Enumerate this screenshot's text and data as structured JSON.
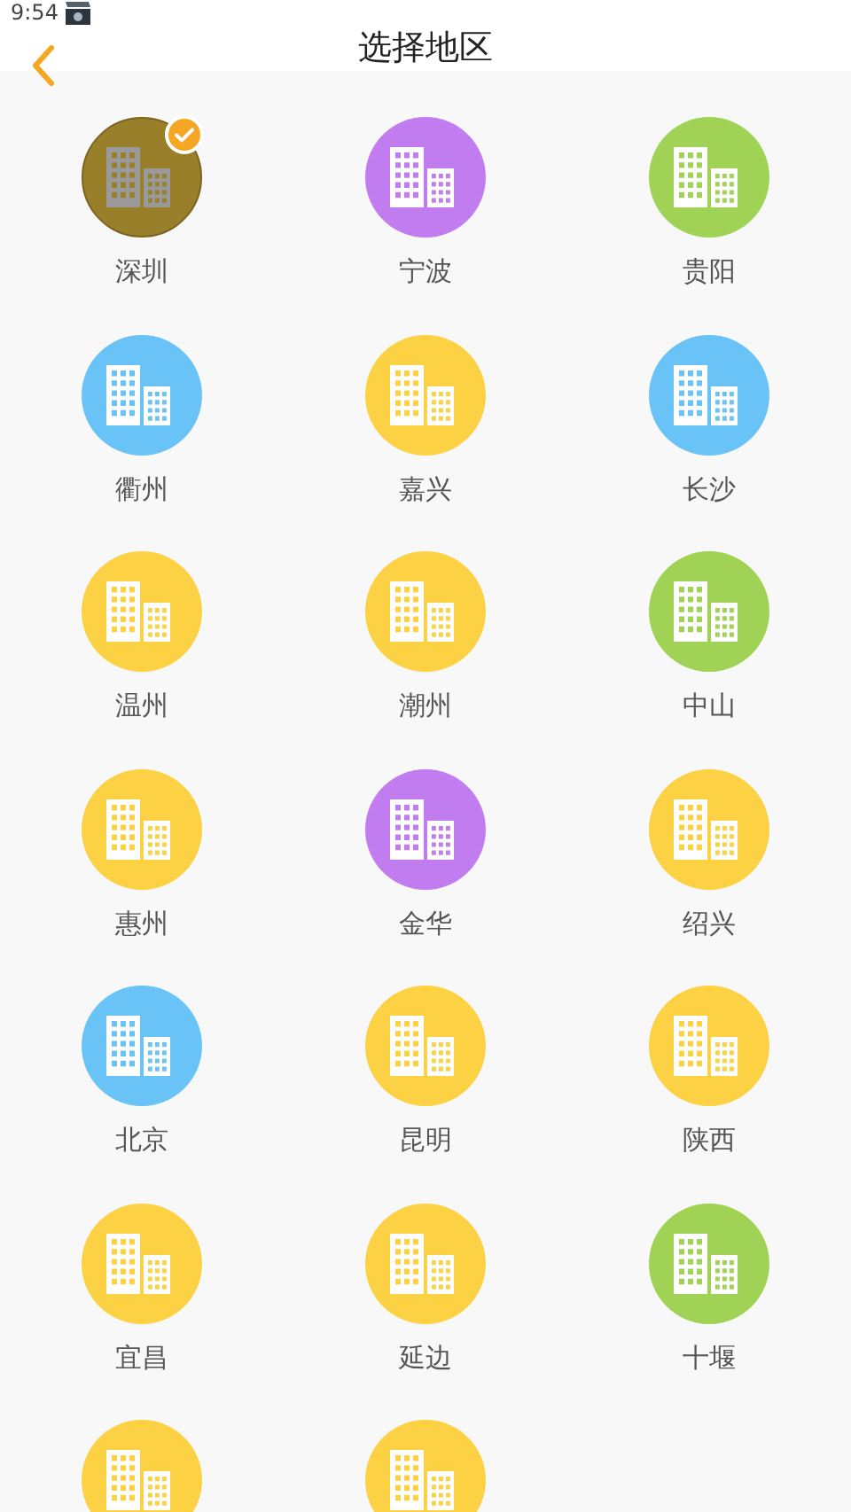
{
  "status_bar": {
    "time": "9:54"
  },
  "header": {
    "title": "选择地区"
  },
  "regions": [
    {
      "name": "深圳",
      "color": "#9a7f2a",
      "selected": true
    },
    {
      "name": "宁波",
      "color": "#c17cf0",
      "selected": false
    },
    {
      "name": "贵阳",
      "color": "#a0d255",
      "selected": false
    },
    {
      "name": "衢州",
      "color": "#6ac3f7",
      "selected": false
    },
    {
      "name": "嘉兴",
      "color": "#fcd144",
      "selected": false
    },
    {
      "name": "长沙",
      "color": "#6ac3f7",
      "selected": false
    },
    {
      "name": "温州",
      "color": "#fcd144",
      "selected": false
    },
    {
      "name": "潮州",
      "color": "#fcd144",
      "selected": false
    },
    {
      "name": "中山",
      "color": "#a0d255",
      "selected": false
    },
    {
      "name": "惠州",
      "color": "#fcd144",
      "selected": false
    },
    {
      "name": "金华",
      "color": "#c17cf0",
      "selected": false
    },
    {
      "name": "绍兴",
      "color": "#fcd144",
      "selected": false
    },
    {
      "name": "北京",
      "color": "#6ac3f7",
      "selected": false
    },
    {
      "name": "昆明",
      "color": "#fcd144",
      "selected": false
    },
    {
      "name": "陕西",
      "color": "#fcd144",
      "selected": false
    },
    {
      "name": "宜昌",
      "color": "#fcd144",
      "selected": false
    },
    {
      "name": "延边",
      "color": "#fcd144",
      "selected": false
    },
    {
      "name": "十堰",
      "color": "#a0d255",
      "selected": false
    },
    {
      "color": "#fcd144",
      "selected": false
    },
    {
      "color": "#fcd144",
      "selected": false
    }
  ]
}
